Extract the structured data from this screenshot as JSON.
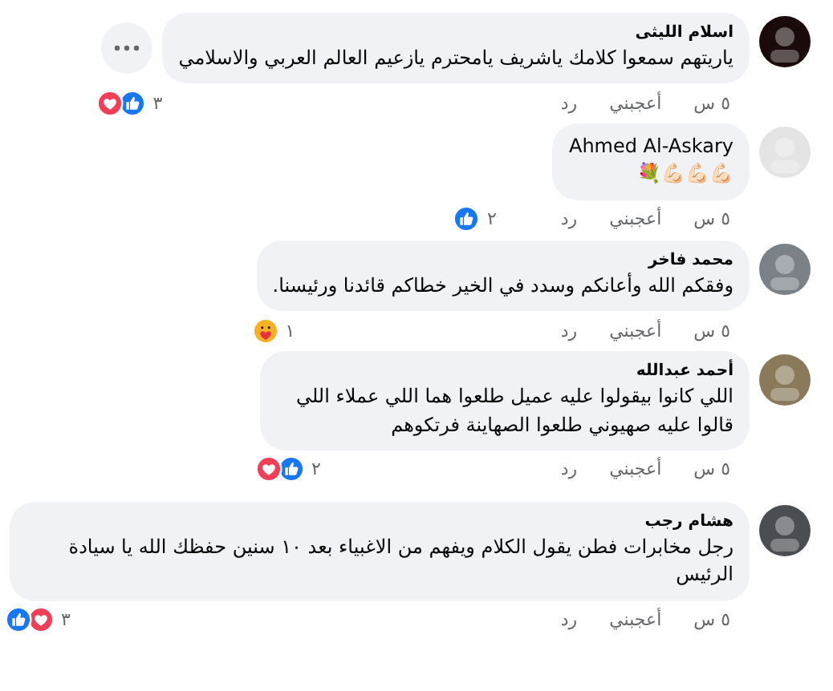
{
  "comments": [
    {
      "author": "اسلام الليثى",
      "text": "ياريتهم سمعوا كلامك ياشريف يامحترم يازعيم العالم العربي والاسلامي",
      "more_menu": true,
      "time": "٥ س",
      "like": "أعجبني",
      "reply": "رد",
      "reactions": [
        {
          "kind": "like"
        },
        {
          "kind": "love"
        }
      ],
      "reaction_count": "٣"
    },
    {
      "author": "Ahmed Al-Askary",
      "text": "💪🏻💪🏻💪🏻💐",
      "more_menu": false,
      "time": "٥ س",
      "like": "أعجبني",
      "reply": "رد",
      "reactions": [
        {
          "kind": "like"
        }
      ],
      "reaction_count": "٢"
    },
    {
      "author": "محمد فاخر",
      "text": "وفقكم الله وأعانكم وسدد في الخير خطاكم قائدنا ورئيسنا.",
      "more_menu": false,
      "time": "٥ س",
      "like": "أعجبني",
      "reply": "رد",
      "reactions": [
        {
          "kind": "care"
        }
      ],
      "reaction_count": "١"
    },
    {
      "author": "أحمد عبدالله",
      "text": "اللي كانوا بيقولوا عليه عميل طلعوا هما اللي عملاء اللي قالوا عليه صهيوني طلعوا الصهاينة فرتكوهم",
      "more_menu": false,
      "time": "٥ س",
      "like": "أعجبني",
      "reply": "رد",
      "reactions": [
        {
          "kind": "like"
        },
        {
          "kind": "love"
        }
      ],
      "reaction_count": "٢"
    },
    {
      "author": "هشام رجب",
      "text": "رجل مخابرات فطن يقول الكلام ويفهم من الاغبياء بعد ١٠ سنين حفظك الله يا سيادة الرئيس",
      "more_menu": false,
      "time": "٥ س",
      "like": "أعجبني",
      "reply": "رد",
      "reactions": [
        {
          "kind": "love"
        },
        {
          "kind": "like"
        }
      ],
      "reaction_count": "٣"
    }
  ]
}
